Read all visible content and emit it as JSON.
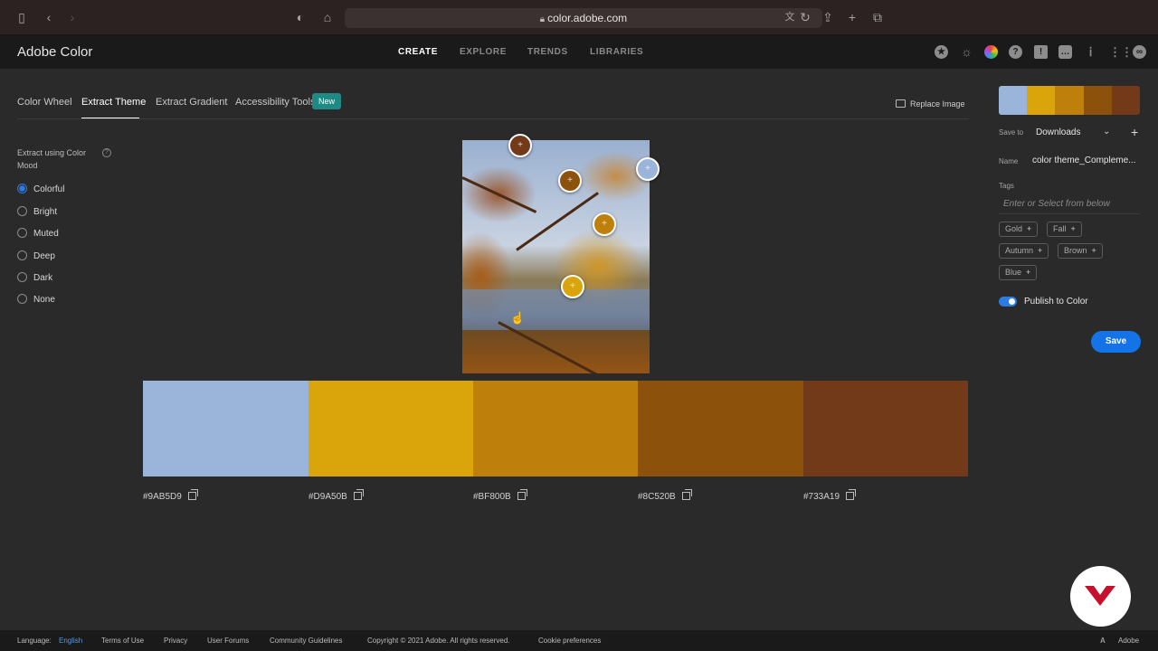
{
  "browser": {
    "url": "color.adobe.com"
  },
  "app": {
    "brand": "Adobe Color",
    "nav": [
      "CREATE",
      "EXPLORE",
      "TRENDS",
      "LIBRARIES"
    ],
    "active_nav": "CREATE"
  },
  "tabs": {
    "items": [
      "Color Wheel",
      "Extract Theme",
      "Extract Gradient",
      "Accessibility Tools"
    ],
    "active": "Extract Theme",
    "new_badge": "New",
    "replace_image": "Replace Image"
  },
  "mood": {
    "label": "Extract using Color Mood",
    "options": [
      "Colorful",
      "Bright",
      "Muted",
      "Deep",
      "Dark",
      "None"
    ],
    "selected": "Colorful"
  },
  "palette": {
    "swatches": [
      {
        "hex": "#9AB5D9",
        "color": "#9AB5D9"
      },
      {
        "hex": "#D9A50B",
        "color": "#D9A50B"
      },
      {
        "hex": "#BF800B",
        "color": "#BF800B"
      },
      {
        "hex": "#8C520B",
        "color": "#8C520B"
      },
      {
        "hex": "#733A19",
        "color": "#733A19"
      }
    ]
  },
  "panel": {
    "save_to_label": "Save to",
    "save_to_value": "Downloads",
    "name_label": "Name",
    "name_value": "color theme_Compleme...",
    "tags_label": "Tags",
    "tags_placeholder": "Enter or Select from below",
    "tags": [
      "Gold",
      "Fall",
      "Autumn",
      "Brown",
      "Blue"
    ],
    "publish_label": "Publish to Color",
    "publish_on": true,
    "save_button": "Save"
  },
  "footer": {
    "language_label": "Language:",
    "language_value": "English",
    "links": [
      "Terms of Use",
      "Privacy",
      "User Forums",
      "Community Guidelines"
    ],
    "copyright": "Copyright © 2021 Adobe. All rights reserved.",
    "cookie": "Cookie preferences",
    "adobe": "Adobe"
  }
}
